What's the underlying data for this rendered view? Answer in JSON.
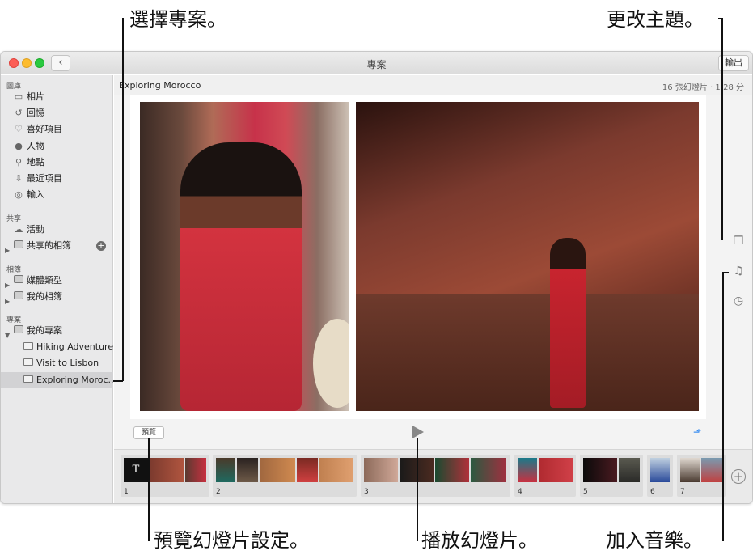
{
  "callouts": {
    "select_project": "選擇專案。",
    "change_theme": "更改主題。",
    "preview_settings": "預覽幻燈片設定。",
    "play_slideshow": "播放幻燈片。",
    "add_music": "加入音樂。"
  },
  "window": {
    "title": "專案",
    "back_icon": "‹",
    "export_label": "輸出"
  },
  "sidebar": {
    "library_header": "圖庫",
    "library_items": [
      {
        "label": "相片",
        "icon": "photos-icon",
        "glyph": "▭"
      },
      {
        "label": "回憶",
        "icon": "memories-icon",
        "glyph": "↺"
      },
      {
        "label": "喜好項目",
        "icon": "heart-icon",
        "glyph": "♡"
      },
      {
        "label": "人物",
        "icon": "person-icon",
        "glyph": "●"
      },
      {
        "label": "地點",
        "icon": "pin-icon",
        "glyph": "⚲"
      },
      {
        "label": "最近項目",
        "icon": "import-icon",
        "glyph": "⇩"
      },
      {
        "label": "輸入",
        "icon": "camera-icon",
        "glyph": "◎"
      }
    ],
    "shared_header": "共享",
    "shared_items": [
      {
        "label": "活動",
        "icon": "cloud-icon",
        "glyph": "☁"
      },
      {
        "label": "共享的相簿",
        "icon": "shared-album-icon",
        "glyph": ""
      }
    ],
    "albums_header": "相簿",
    "album_items": [
      {
        "label": "媒體類型"
      },
      {
        "label": "我的相簿"
      }
    ],
    "projects_header": "專案",
    "my_projects_label": "我的專案",
    "project_items": [
      {
        "label": "Hiking Adventure"
      },
      {
        "label": "Visit to Lisbon"
      },
      {
        "label": "Exploring Moroc..."
      }
    ],
    "plus_label": "+"
  },
  "main": {
    "project_title": "Exploring Morocco",
    "project_info": "16 張幻燈片 · 1:28 分",
    "preview_label": "預覽",
    "aspect_icon": "⬏"
  },
  "tools": {
    "theme_icon": "❐",
    "music_icon": "♫",
    "duration_icon": "◷"
  },
  "filmstrip": {
    "groups": [
      {
        "number": "1",
        "title_glyph": "T"
      },
      {
        "number": "2"
      },
      {
        "number": "3"
      },
      {
        "number": "4"
      },
      {
        "number": "5"
      },
      {
        "number": "6"
      },
      {
        "number": "7"
      }
    ],
    "add_label": "+"
  }
}
